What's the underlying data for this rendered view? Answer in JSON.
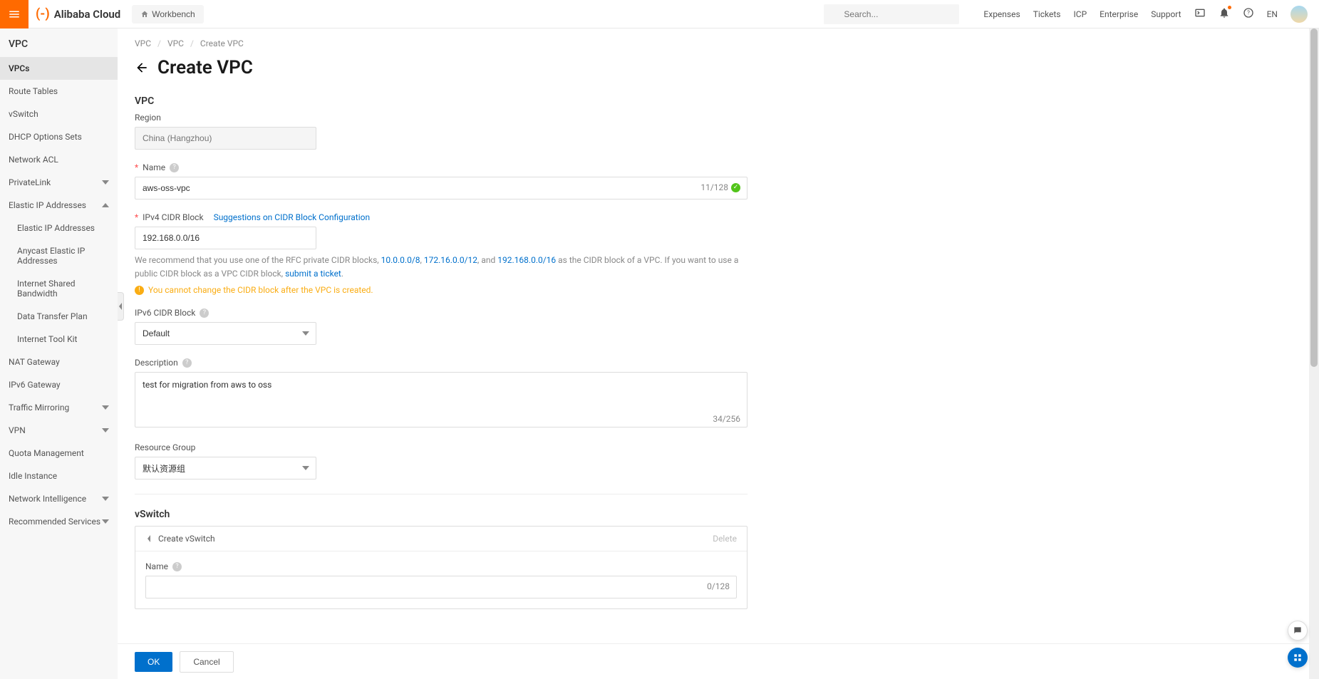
{
  "header": {
    "brand": "Alibaba Cloud",
    "workbench": "Workbench",
    "search_placeholder": "Search...",
    "links": [
      "Expenses",
      "Tickets",
      "ICP",
      "Enterprise",
      "Support"
    ],
    "lang": "EN"
  },
  "sidebar": {
    "title": "VPC",
    "items": [
      {
        "label": "VPCs",
        "active": true
      },
      {
        "label": "Route Tables"
      },
      {
        "label": "vSwitch"
      },
      {
        "label": "DHCP Options Sets"
      },
      {
        "label": "Network ACL"
      },
      {
        "label": "PrivateLink",
        "chevron": "down"
      },
      {
        "label": "Elastic IP Addresses",
        "chevron": "up"
      },
      {
        "label": "Elastic IP Addresses",
        "sub": true
      },
      {
        "label": "Anycast Elastic IP Addresses",
        "sub": true
      },
      {
        "label": "Internet Shared Bandwidth",
        "sub": true
      },
      {
        "label": "Data Transfer Plan",
        "sub": true
      },
      {
        "label": "Internet Tool Kit",
        "sub": true
      },
      {
        "label": "NAT Gateway"
      },
      {
        "label": "IPv6 Gateway"
      },
      {
        "label": "Traffic Mirroring",
        "chevron": "down"
      },
      {
        "label": "VPN",
        "chevron": "down"
      },
      {
        "label": "Quota Management"
      },
      {
        "label": "Idle Instance"
      },
      {
        "label": "Network Intelligence",
        "chevron": "down"
      },
      {
        "label": "Recommended Services",
        "chevron": "down"
      }
    ]
  },
  "breadcrumb": {
    "a": "VPC",
    "b": "VPC",
    "c": "Create VPC"
  },
  "page_title": "Create VPC",
  "section_vpc": "VPC",
  "region": {
    "label": "Region",
    "value": "China (Hangzhou)"
  },
  "name": {
    "label": "Name",
    "value": "aws-oss-vpc",
    "counter": "11/128"
  },
  "cidr": {
    "label": "IPv4 CIDR Block",
    "suggestion_link": "Suggestions on CIDR Block Configuration",
    "value": "192.168.0.0/16",
    "hint_pre": "We recommend that you use one of the RFC private CIDR blocks, ",
    "link1": "10.0.0.0/8",
    "link2": "172.16.0.0/12",
    "link3": "192.168.0.0/16",
    "hint_mid": " as the CIDR block of a VPC. If you want to use a public CIDR block as a VPC CIDR block, ",
    "submit_link": "submit a ticket",
    "hint_end": ".",
    "warn": "You cannot change the CIDR block after the VPC is created."
  },
  "ipv6": {
    "label": "IPv6 CIDR Block",
    "value": "Default"
  },
  "description": {
    "label": "Description",
    "value": "test for migration from aws to oss",
    "counter": "34/256"
  },
  "resource_group": {
    "label": "Resource Group",
    "value": "默认资源组"
  },
  "section_vswitch": "vSwitch",
  "vswitch_panel": {
    "title": "Create vSwitch",
    "delete": "Delete",
    "name_label": "Name",
    "name_counter": "0/128"
  },
  "footer": {
    "ok": "OK",
    "cancel": "Cancel"
  }
}
